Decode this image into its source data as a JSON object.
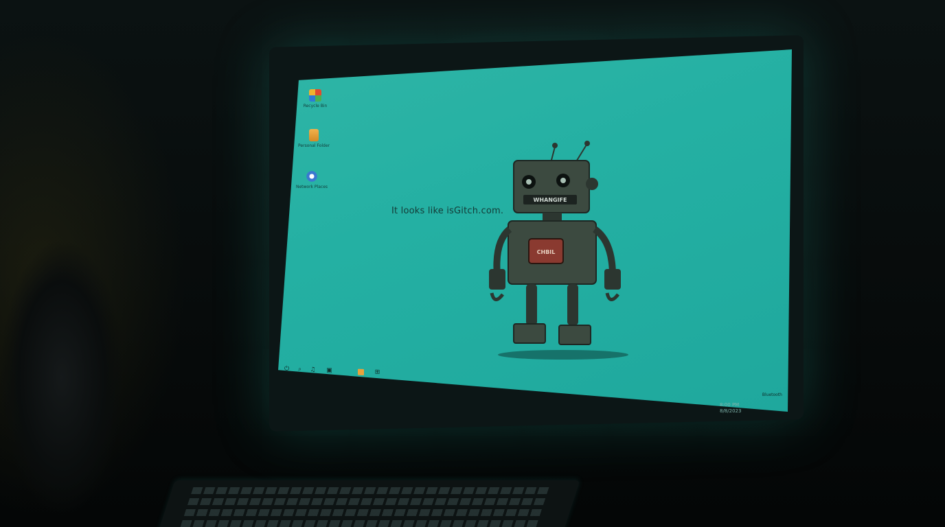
{
  "desktop": {
    "icons": [
      {
        "label": "Recycle Bin",
        "icon": "windows-logo-icon",
        "color": "#e0a030"
      },
      {
        "label": "Personal Folder",
        "icon": "folder-icon",
        "color": "#e8a23c"
      },
      {
        "label": "Network Places",
        "icon": "network-icon",
        "color": "#3a78d0"
      }
    ],
    "message": "It looks like isGitch.com.",
    "robot": {
      "face_label": "WHANGIFE",
      "chest_label": "CHBIL"
    }
  },
  "taskbar": {
    "icons": [
      "power-icon",
      "search-icon",
      "music-icon",
      "app-icon",
      "folder-icon",
      "grid-icon"
    ],
    "tray_text": "Bluetooth",
    "clock_time": "8:00 PM",
    "clock_date": "8/8/2023"
  },
  "colors": {
    "screen": "#24b0a3",
    "robot_body": "#3c4a40",
    "robot_plate": "#8a3a30"
  }
}
